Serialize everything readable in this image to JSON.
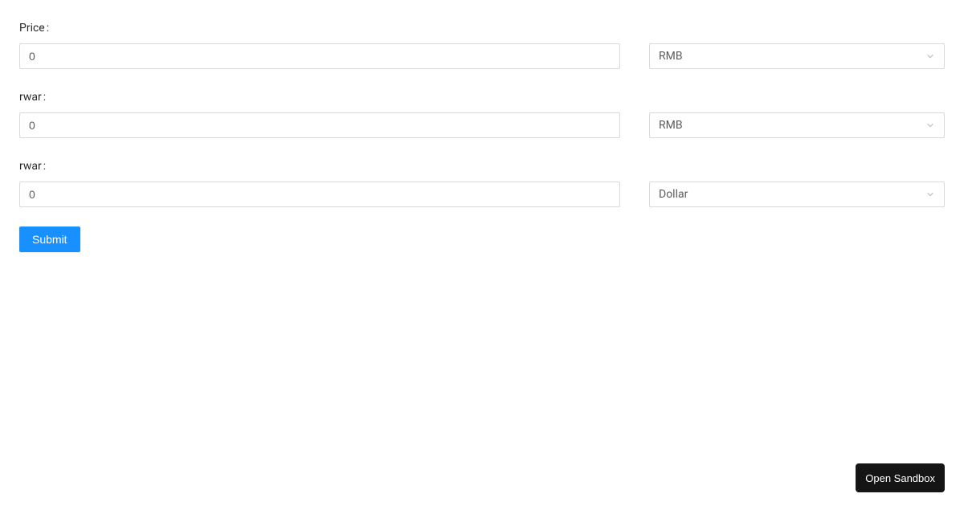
{
  "form": {
    "fields": [
      {
        "label": "Price",
        "value": "0",
        "currency": "RMB"
      },
      {
        "label": "rwar",
        "value": "0",
        "currency": "RMB"
      },
      {
        "label": "rwar",
        "value": "0",
        "currency": "Dollar"
      }
    ],
    "submit_label": "Submit"
  },
  "sandbox": {
    "button_label": "Open Sandbox"
  }
}
